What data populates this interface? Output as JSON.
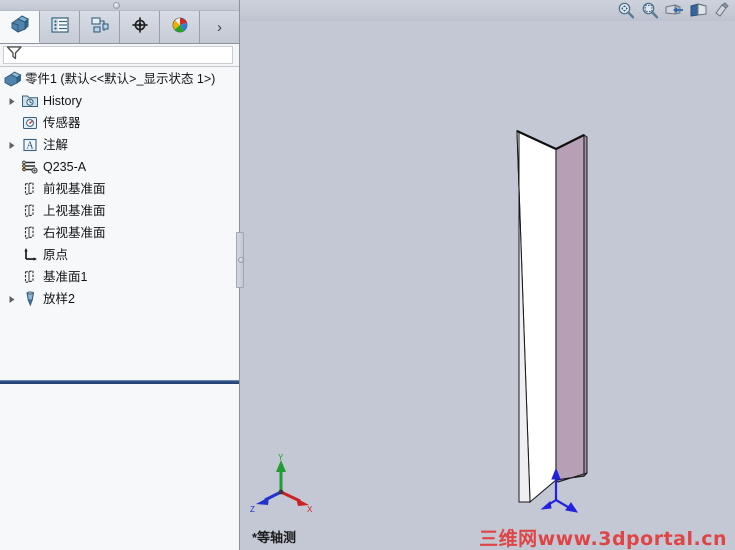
{
  "app": {
    "view_label": "*等轴测",
    "watermark": "三维网www.3dportal.cn"
  },
  "colors": {
    "graphics_background": "#c3c8d4",
    "panel_background": "#f7f8fa",
    "model_face_light": "#ffffff",
    "model_face_shaded": "#b7a0b5",
    "model_edge": "#1a1a1a",
    "rollback_bar": "#2c4d82",
    "watermark_color": "#e33a3a",
    "triad_x": "#cc2222",
    "triad_y": "#1f9e2f",
    "triad_z": "#2233cc",
    "origin_marker": "#2222dd"
  },
  "panel": {
    "tabs": [
      {
        "name": "feature-manager-tab",
        "icon": "feature-tree-icon",
        "active": true
      },
      {
        "name": "property-manager-tab",
        "icon": "property-list-icon",
        "active": false
      },
      {
        "name": "configuration-manager-tab",
        "icon": "configuration-icon",
        "active": false
      },
      {
        "name": "dimxpert-manager-tab",
        "icon": "dimxpert-target-icon",
        "active": false
      },
      {
        "name": "display-manager-tab",
        "icon": "display-color-wheel-icon",
        "active": false
      }
    ],
    "more_tabs_label": "›",
    "filter": {
      "icon": "filter-funnel-icon",
      "value": "",
      "placeholder": ""
    }
  },
  "tree": {
    "root": {
      "icon": "part-icon",
      "label": "零件1  (默认<<默认>_显示状态 1>)"
    },
    "items": [
      {
        "label": "History",
        "icon": "history-folder-icon",
        "expandable": true,
        "indent": 1
      },
      {
        "label": "传感器",
        "icon": "sensor-icon",
        "expandable": false,
        "indent": 1
      },
      {
        "label": "注解",
        "icon": "annotations-icon",
        "expandable": true,
        "indent": 1
      },
      {
        "label": "Q235-A",
        "icon": "material-icon",
        "expandable": false,
        "indent": 1
      },
      {
        "label": "前视基准面",
        "icon": "plane-icon",
        "expandable": false,
        "indent": 1
      },
      {
        "label": "上视基准面",
        "icon": "plane-icon",
        "expandable": false,
        "indent": 1
      },
      {
        "label": "右视基准面",
        "icon": "plane-icon",
        "expandable": false,
        "indent": 1
      },
      {
        "label": "原点",
        "icon": "origin-icon",
        "expandable": false,
        "indent": 1
      },
      {
        "label": "基准面1",
        "icon": "plane-icon",
        "expandable": false,
        "indent": 1
      },
      {
        "label": "放样2",
        "icon": "loft-icon",
        "expandable": true,
        "indent": 1
      }
    ]
  },
  "toolbar_right": [
    {
      "name": "zoom-to-fit-icon"
    },
    {
      "name": "zoom-to-area-icon"
    },
    {
      "name": "section-view-icon"
    },
    {
      "name": "view-orientation-icon"
    },
    {
      "name": "display-style-icon"
    }
  ],
  "triad": {
    "x_label": "X",
    "y_label": "Y",
    "z_label": "Z"
  }
}
